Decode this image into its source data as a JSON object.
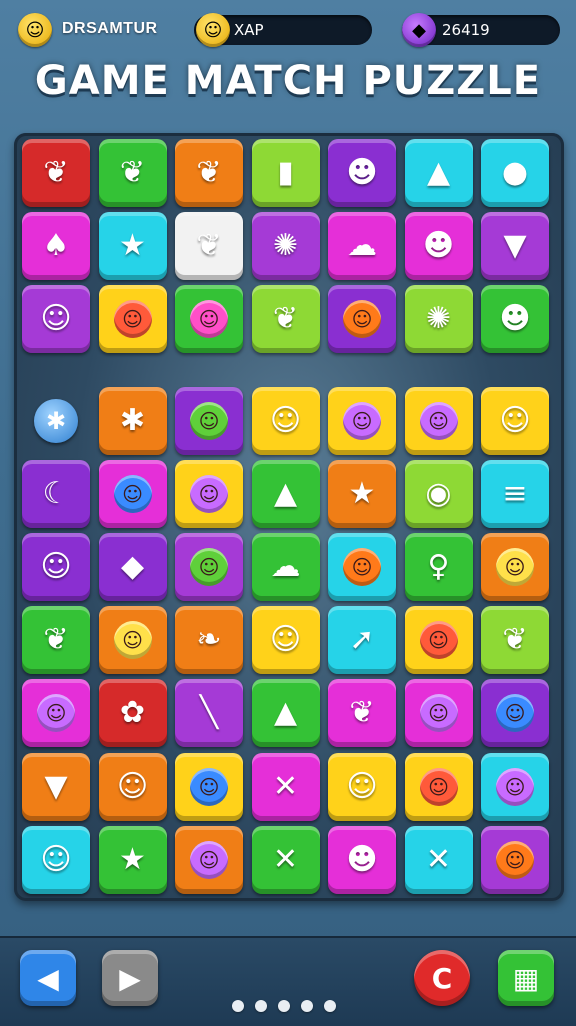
{
  "top_bar": {
    "player_name": "DRSAMTUR",
    "label_middle": "XAP",
    "score": "26419",
    "icons": [
      "coin-icon",
      "coin-icon",
      "gem-icon"
    ]
  },
  "title": "GAME MATCH PUZZLE",
  "board": {
    "columns": 7,
    "rows": 10,
    "tiles": [
      [
        [
          "#d62a2a",
          "leaf"
        ],
        [
          "#34c236",
          "leaf"
        ],
        [
          "#f07e16",
          "leaf"
        ],
        [
          "#8ed935",
          "popsicle"
        ],
        [
          "#8a2fd1",
          "crab"
        ],
        [
          "#26d3e8",
          "carrot"
        ],
        [
          "#26d3e8",
          "apple"
        ]
      ],
      [
        [
          "#e52fd8",
          "icecream"
        ],
        [
          "#26d3e8",
          "star"
        ],
        [
          "#f2f2f2",
          "leaf"
        ],
        [
          "#a53ad6",
          "splat"
        ],
        [
          "#e52fd8",
          "cloud"
        ],
        [
          "#e52fd8",
          "blob"
        ],
        [
          "#a53ad6",
          "cone"
        ]
      ],
      [
        [
          "#a53ad6",
          "face"
        ],
        [
          "#ffd21a",
          "orb-red"
        ],
        [
          "#34c236",
          "orb-pink"
        ],
        [
          "#8ed935",
          "leaf"
        ],
        [
          "#8a2fd1",
          "orb-orange"
        ],
        [
          "#8ed935",
          "splat"
        ],
        [
          "#34c236",
          "ghost"
        ]
      ],
      [
        [
          "none",
          "ball"
        ],
        [
          "#f07e16",
          "ball"
        ],
        [
          "#8a2fd1",
          "orb-green"
        ],
        [
          "#ffd21a",
          "face"
        ],
        [
          "#ffd21a",
          "orb-purple"
        ],
        [
          "#ffd21a",
          "orb-purple"
        ],
        [
          "#ffd21a",
          "face"
        ]
      ],
      [
        [
          "#8a2fd1",
          "banana"
        ],
        [
          "#e52fd8",
          "orb-blue"
        ],
        [
          "#ffd21a",
          "orb-purple"
        ],
        [
          "#34c236",
          "carrot"
        ],
        [
          "#f07e16",
          "star"
        ],
        [
          "#8ed935",
          "melon"
        ],
        [
          "#26d3e8",
          "coins"
        ]
      ],
      [
        [
          "#8a2fd1",
          "face"
        ],
        [
          "#8a2fd1",
          "cheese"
        ],
        [
          "#a53ad6",
          "orb-green"
        ],
        [
          "#34c236",
          "cloud"
        ],
        [
          "#26d3e8",
          "orb-orange"
        ],
        [
          "#34c236",
          "lollipop"
        ],
        [
          "#f07e16",
          "orb-yellow"
        ]
      ],
      [
        [
          "#34c236",
          "leaf"
        ],
        [
          "#f07e16",
          "orb-yellow"
        ],
        [
          "#f07e16",
          "feather"
        ],
        [
          "#ffd21a",
          "face"
        ],
        [
          "#26d3e8",
          "arrow"
        ],
        [
          "#ffd21a",
          "orb-red"
        ],
        [
          "#8ed935",
          "leaf"
        ]
      ],
      [
        [
          "#e52fd8",
          "orb-purple"
        ],
        [
          "#d62a2a",
          "flower"
        ],
        [
          "#a53ad6",
          "rod"
        ],
        [
          "#34c236",
          "carrot"
        ],
        [
          "#e52fd8",
          "leaf"
        ],
        [
          "#e52fd8",
          "orb-purple"
        ],
        [
          "#8a2fd1",
          "orb-blue"
        ]
      ],
      [
        [
          "#f07e16",
          "cone"
        ],
        [
          "#f07e16",
          "face"
        ],
        [
          "#ffd21a",
          "orb-blue"
        ],
        [
          "#e52fd8",
          "tool"
        ],
        [
          "#ffd21a",
          "face"
        ],
        [
          "#ffd21a",
          "orb-red"
        ],
        [
          "#26d3e8",
          "orb-purple"
        ]
      ],
      [
        [
          "#26d3e8",
          "face"
        ],
        [
          "#34c236",
          "star"
        ],
        [
          "#f07e16",
          "orb-purple"
        ],
        [
          "#34c236",
          "cross"
        ],
        [
          "#e52fd8",
          "chick"
        ],
        [
          "#26d3e8",
          "cross"
        ],
        [
          "#a53ad6",
          "orb-orange"
        ]
      ]
    ]
  },
  "bottom_bar": {
    "buttons": [
      {
        "name": "back-button",
        "glyph": "◀",
        "color": "#2f86e8"
      },
      {
        "name": "play-button",
        "glyph": "▶",
        "color": "#8a8a8a"
      },
      {
        "name": "restart-button",
        "glyph": "C",
        "color": "#e02a2a"
      },
      {
        "name": "menu-button",
        "glyph": "▦",
        "color": "#34c236"
      }
    ],
    "page_dots": 5
  }
}
